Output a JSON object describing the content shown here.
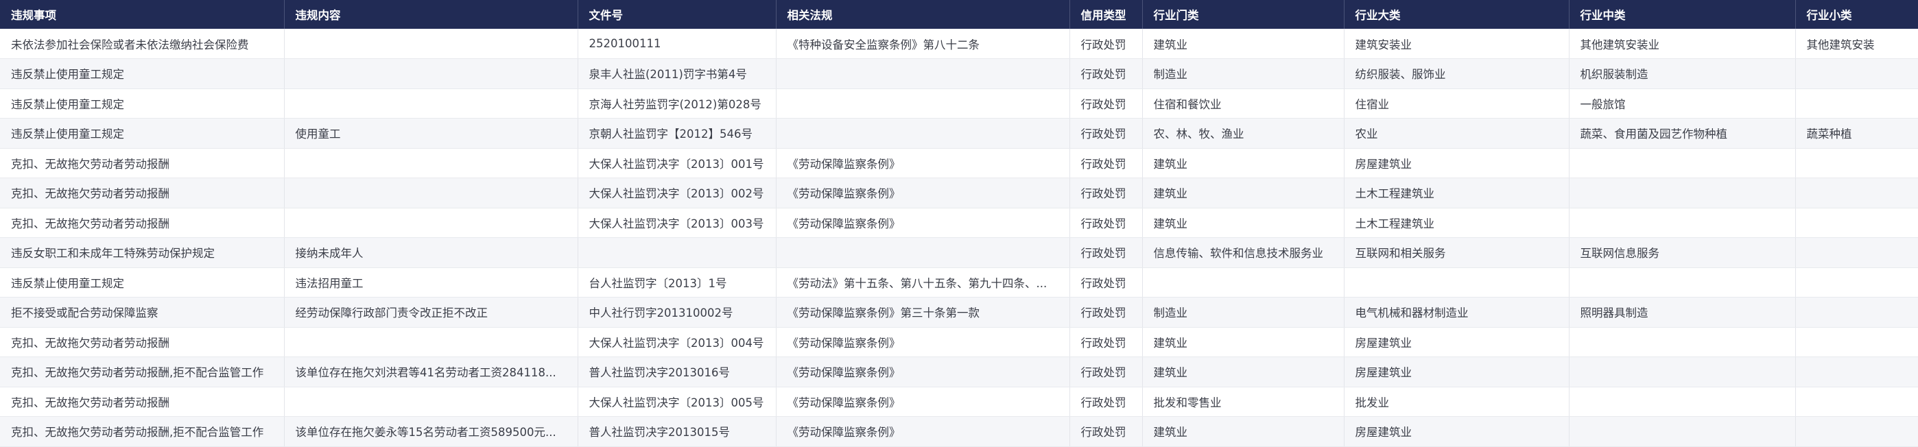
{
  "table": {
    "columns": [
      "违规事项",
      "违规内容",
      "文件号",
      "相关法规",
      "信用类型",
      "行业门类",
      "行业大类",
      "行业中类",
      "行业小类"
    ],
    "rows": [
      [
        "未依法参加社会保险或者未依法缴纳社会保险费",
        "",
        "2520100111",
        "《特种设备安全监察条例》第八十二条",
        "行政处罚",
        "建筑业",
        "建筑安装业",
        "其他建筑安装业",
        "其他建筑安装"
      ],
      [
        "违反禁止使用童工规定",
        "",
        "泉丰人社监(2011)罚字书第4号",
        "",
        "行政处罚",
        "制造业",
        "纺织服装、服饰业",
        "机织服装制造",
        ""
      ],
      [
        "违反禁止使用童工规定",
        "",
        "京海人社劳监罚字(2012)第028号",
        "",
        "行政处罚",
        "住宿和餐饮业",
        "住宿业",
        "一般旅馆",
        ""
      ],
      [
        "违反禁止使用童工规定",
        "使用童工",
        "京朝人社监罚字【2012】546号",
        "",
        "行政处罚",
        "农、林、牧、渔业",
        "农业",
        "蔬菜、食用菌及园艺作物种植",
        "蔬菜种植"
      ],
      [
        "克扣、无故拖欠劳动者劳动报酬",
        "",
        "大保人社监罚决字〔2013〕001号",
        "《劳动保障监察条例》",
        "行政处罚",
        "建筑业",
        "房屋建筑业",
        "",
        ""
      ],
      [
        "克扣、无故拖欠劳动者劳动报酬",
        "",
        "大保人社监罚决字〔2013〕002号",
        "《劳动保障监察条例》",
        "行政处罚",
        "建筑业",
        "土木工程建筑业",
        "",
        ""
      ],
      [
        "克扣、无故拖欠劳动者劳动报酬",
        "",
        "大保人社监罚决字〔2013〕003号",
        "《劳动保障监察条例》",
        "行政处罚",
        "建筑业",
        "土木工程建筑业",
        "",
        ""
      ],
      [
        "违反女职工和未成年工特殊劳动保护规定",
        "接纳未成年人",
        "",
        "",
        "行政处罚",
        "信息传输、软件和信息技术服务业",
        "互联网和相关服务",
        "互联网信息服务",
        ""
      ],
      [
        "违反禁止使用童工规定",
        "违法招用童工",
        "台人社监罚字〔2013〕1号",
        "《劳动法》第十五条、第八十五条、第九十四条、...",
        "行政处罚",
        "",
        "",
        "",
        ""
      ],
      [
        "拒不接受或配合劳动保障监察",
        "经劳动保障行政部门责令改正拒不改正",
        "中人社行罚字201310002号",
        "《劳动保障监察条例》第三十条第一款",
        "行政处罚",
        "制造业",
        "电气机械和器材制造业",
        "照明器具制造",
        ""
      ],
      [
        "克扣、无故拖欠劳动者劳动报酬",
        "",
        "大保人社监罚决字〔2013〕004号",
        "《劳动保障监察条例》",
        "行政处罚",
        "建筑业",
        "房屋建筑业",
        "",
        ""
      ],
      [
        "克扣、无故拖欠劳动者劳动报酬,拒不配合监管工作",
        "该单位存在拖欠刘洪君等41名劳动者工资284118...",
        "普人社监罚决字2013016号",
        "《劳动保障监察条例》",
        "行政处罚",
        "建筑业",
        "房屋建筑业",
        "",
        ""
      ],
      [
        "克扣、无故拖欠劳动者劳动报酬",
        "",
        "大保人社监罚决字〔2013〕005号",
        "《劳动保障监察条例》",
        "行政处罚",
        "批发和零售业",
        "批发业",
        "",
        ""
      ],
      [
        "克扣、无故拖欠劳动者劳动报酬,拒不配合监管工作",
        "该单位存在拖欠姜永等15名劳动者工资589500元...",
        "普人社监罚决字2013015号",
        "《劳动保障监察条例》",
        "行政处罚",
        "建筑业",
        "房屋建筑业",
        "",
        ""
      ]
    ]
  }
}
